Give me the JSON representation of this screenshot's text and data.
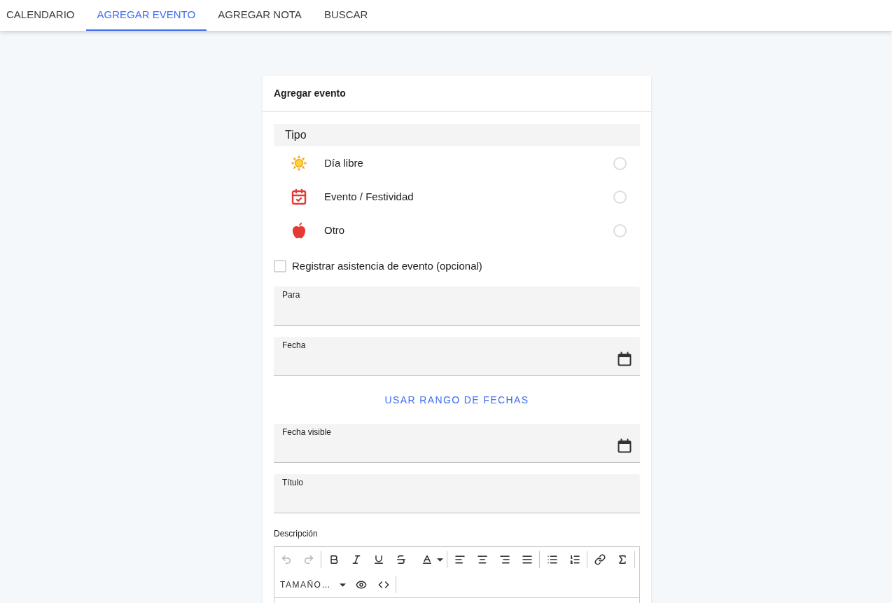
{
  "tabs": [
    {
      "label": "CALENDARIO",
      "selected": false
    },
    {
      "label": "AGREGAR EVENTO",
      "selected": true
    },
    {
      "label": "AGREGAR NOTA",
      "selected": false
    },
    {
      "label": "BUSCAR",
      "selected": false
    }
  ],
  "card": {
    "title": "Agregar evento",
    "type_section": {
      "title": "Tipo",
      "options": [
        {
          "kind": "day_off",
          "label": "Día libre",
          "selected": false
        },
        {
          "kind": "event",
          "label": "Evento / Festividad",
          "selected": false
        },
        {
          "kind": "other",
          "label": "Otro",
          "selected": false
        }
      ]
    },
    "attendance": {
      "label": "Registrar asistencia de evento (opcional)",
      "checked": false
    },
    "form_items": [
      {
        "kind": "text",
        "label": "Para"
      },
      {
        "kind": "date",
        "label": "Fecha"
      },
      {
        "kind": "action",
        "label": "USAR RANGO DE FECHAS"
      },
      {
        "kind": "date",
        "label": "Fecha visible"
      },
      {
        "kind": "text",
        "label": "Título"
      }
    ],
    "description": {
      "label": "Descripción",
      "toolbar": [
        [
          {
            "kind": "undo",
            "disabled": true
          },
          {
            "kind": "redo",
            "disabled": true
          }
        ],
        [
          {
            "kind": "bold",
            "disabled": false
          },
          {
            "kind": "italic",
            "disabled": false
          },
          {
            "kind": "underline",
            "disabled": false
          },
          {
            "kind": "strikethrough",
            "disabled": false
          },
          {
            "kind": "color",
            "disabled": false
          }
        ],
        [
          {
            "kind": "align_left",
            "disabled": false
          },
          {
            "kind": "align_center",
            "disabled": false
          },
          {
            "kind": "align_right",
            "disabled": false
          },
          {
            "kind": "justify",
            "disabled": false
          }
        ],
        [
          {
            "kind": "bullet_list",
            "disabled": false
          },
          {
            "kind": "numbered_list",
            "disabled": false
          }
        ],
        [
          {
            "kind": "link",
            "disabled": false
          },
          {
            "kind": "formula",
            "disabled": false
          }
        ],
        [
          {
            "kind": "size",
            "label": "TAMAÑO…",
            "disabled": false
          },
          {
            "kind": "preview",
            "disabled": false
          },
          {
            "kind": "code",
            "disabled": false
          }
        ]
      ]
    }
  }
}
